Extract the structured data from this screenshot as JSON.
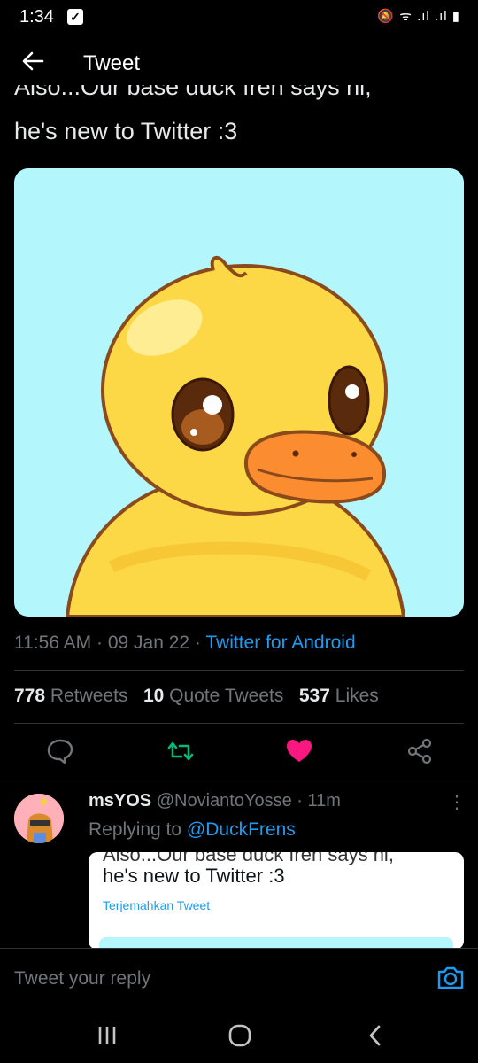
{
  "status_bar": {
    "time": "1:34",
    "icons": "🔕 ᯤ .ıl .ıl ▮"
  },
  "header": {
    "title": "Tweet"
  },
  "tweet": {
    "text_cut": "Also...Our base duck fren says hi,",
    "text_line": "he's new to Twitter :3",
    "time": "11:56 AM",
    "date": "09 Jan 22",
    "source": "Twitter for Android",
    "retweets_count": "778",
    "retweets_label": "Retweets",
    "quotes_count": "10",
    "quotes_label": "Quote Tweets",
    "likes_count": "537",
    "likes_label": "Likes"
  },
  "reply": {
    "display_name": "msYOS",
    "handle": "@NoviantoYosse",
    "age": "11m",
    "replying_to_label": "Replying to",
    "replying_to_handle": "@DuckFrens",
    "quote_cut": "Also...Our base duck fren says hi,",
    "quote_line": "he's new to Twitter :3",
    "translate_label": "Terjemahkan Tweet"
  },
  "compose": {
    "placeholder": "Tweet your reply"
  },
  "colors": {
    "accent": "#1d9bf0",
    "retweet": "#00ba7c",
    "like": "#f91880",
    "image_bg": "#b3f6fb"
  },
  "icons": [
    "back-arrow-icon",
    "reply-icon",
    "retweet-icon",
    "heart-icon",
    "share-icon",
    "more-icon",
    "camera-icon",
    "recents-icon",
    "home-icon",
    "nav-back-icon"
  ]
}
